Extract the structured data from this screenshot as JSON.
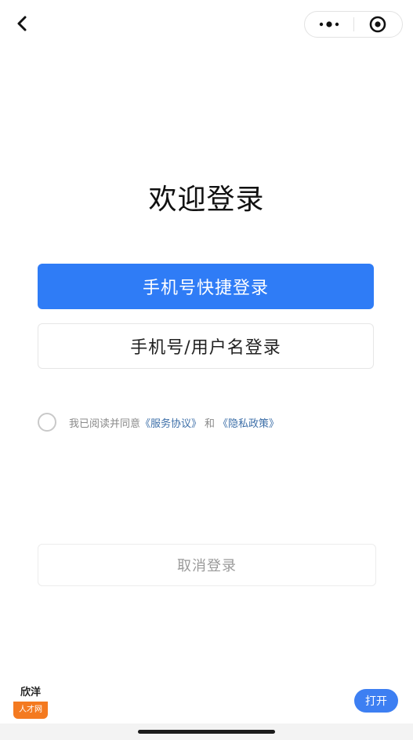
{
  "nav": {
    "back_icon": "chevron-left-icon",
    "more_icon": "more-dots-icon",
    "close_icon": "target-circle-icon"
  },
  "title": "欢迎登录",
  "buttons": {
    "quick_login": "手机号快捷登录",
    "account_login": "手机号/用户名登录",
    "cancel_login": "取消登录"
  },
  "agreement": {
    "checked": false,
    "prefix": "我已阅读并同意",
    "service_link": "《服务协议》",
    "conjunction": "和",
    "privacy_link": "《隐私政策》"
  },
  "footer": {
    "logo_top": "欣洋",
    "logo_bottom": "人才网",
    "open_label": "打开"
  },
  "colors": {
    "primary": "#2f7cf6",
    "link": "#3d6fa8",
    "logo_orange": "#f47a20"
  }
}
